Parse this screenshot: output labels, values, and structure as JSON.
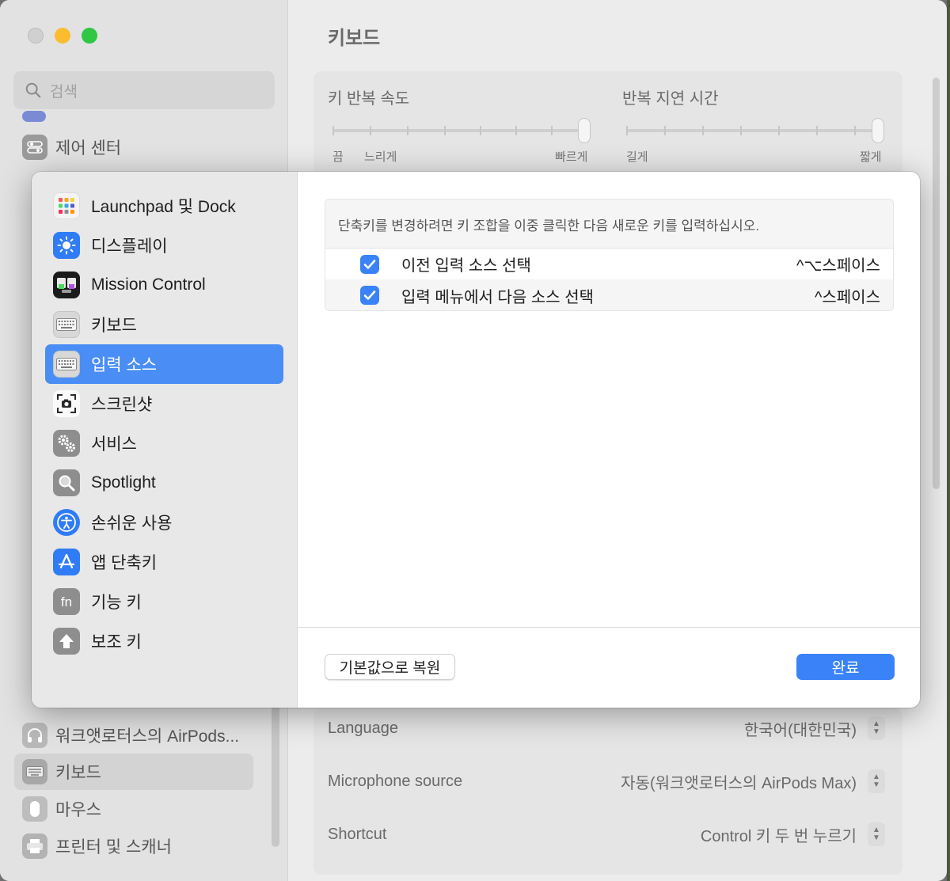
{
  "background_window": {
    "title": "키보드",
    "search_placeholder": "검색",
    "sidebar_items": [
      {
        "label": "제어 센터",
        "icon": "control-center-icon"
      },
      {
        "label": "워크앳로터스의 AirPods...",
        "icon": "headphones-icon"
      },
      {
        "label": "키보드",
        "icon": "keyboard-icon",
        "selected": true
      },
      {
        "label": "마우스",
        "icon": "mouse-icon"
      },
      {
        "label": "프린터 및 스캐너",
        "icon": "printer-icon"
      }
    ],
    "key_repeat": {
      "label": "키 반복 속도",
      "scale_labels": [
        "끔",
        "느리게",
        "빠르게"
      ]
    },
    "repeat_delay": {
      "label": "반복 지연 시간",
      "scale_labels": [
        "길게",
        "짧게"
      ]
    },
    "dictation_rows": [
      {
        "label": "Language",
        "value": "한국어(대한민국)"
      },
      {
        "label": "Microphone source",
        "value": "자동(워크앳로터스의 AirPods Max)"
      },
      {
        "label": "Shortcut",
        "value": "Control 키 두 번 누르기"
      }
    ]
  },
  "sheet": {
    "categories": [
      {
        "label": "Launchpad 및 Dock",
        "icon": "launchpad-icon"
      },
      {
        "label": "디스플레이",
        "icon": "display-icon"
      },
      {
        "label": "Mission Control",
        "icon": "mission-control-icon"
      },
      {
        "label": "키보드",
        "icon": "keyboard-icon"
      },
      {
        "label": "입력 소스",
        "icon": "input-sources-icon",
        "active": true
      },
      {
        "label": "스크린샷",
        "icon": "screenshot-icon"
      },
      {
        "label": "서비스",
        "icon": "services-icon"
      },
      {
        "label": "Spotlight",
        "icon": "spotlight-icon"
      },
      {
        "label": "손쉬운 사용",
        "icon": "accessibility-icon"
      },
      {
        "label": "앱 단축키",
        "icon": "app-store-icon"
      },
      {
        "label": "기능 키",
        "icon": "fn-icon"
      },
      {
        "label": "보조 키",
        "icon": "modifier-key-icon"
      }
    ],
    "hint": "단축키를 변경하려면 키 조합을 이중 클릭한 다음 새로운 키를 입력하십시오.",
    "shortcuts": [
      {
        "name": "이전 입력 소스 선택",
        "keys": "^⌥스페이스",
        "checked": true
      },
      {
        "name": "입력 메뉴에서 다음 소스 선택",
        "keys": "^스페이스",
        "checked": true
      }
    ],
    "reset_label": "기본값으로 복원",
    "done_label": "완료"
  },
  "colors": {
    "accent": "#3a82f7",
    "selection": "#4a8ef5"
  }
}
